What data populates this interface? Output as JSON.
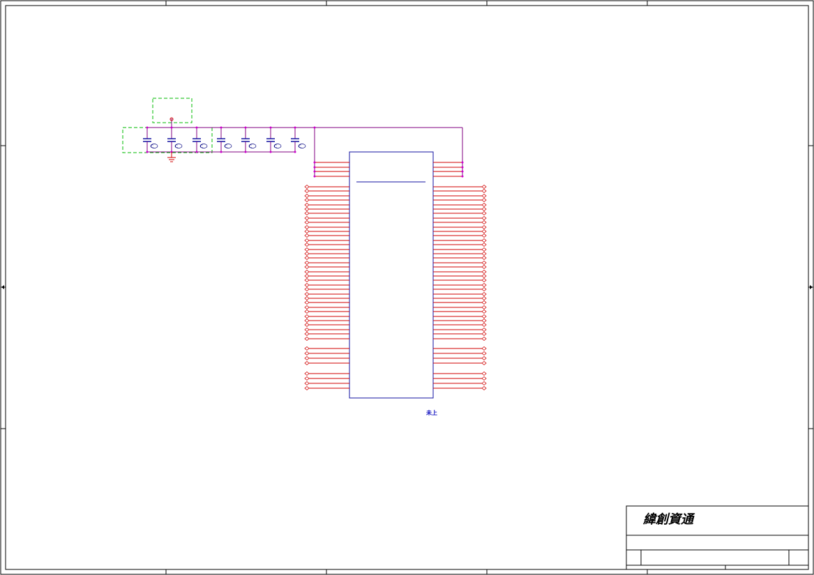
{
  "title_block": {
    "company": "緯創資通"
  },
  "part_note": "未上",
  "capacitor_labels": [
    "C",
    "C",
    "C",
    "C",
    "C",
    "C",
    "C"
  ],
  "colors": {
    "border": "#000000",
    "component": "#1010a0",
    "wire": "#800080",
    "pin_wire": "#d00000",
    "dashed_box": "#00bb00",
    "junction": "#cc00cc",
    "ground": "#d00000"
  }
}
